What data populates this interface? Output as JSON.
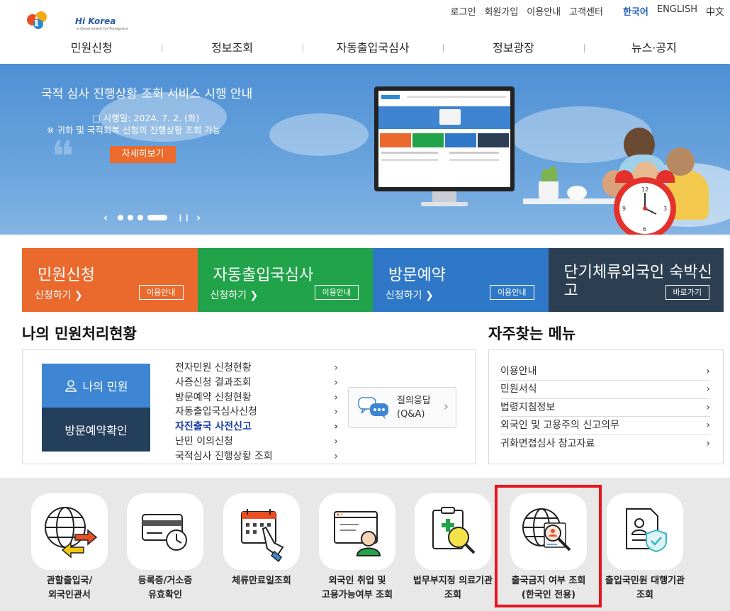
{
  "header": {
    "logo_text": "Hi Korea",
    "logo_sub": "e-Government for Foreigners",
    "utils": [
      "로그인",
      "회원가입",
      "이용안내",
      "고객센터"
    ],
    "langs": [
      "한국어",
      "ENGLISH",
      "中文"
    ]
  },
  "gnb": [
    "민원신청",
    "정보조회",
    "자동출입국심사",
    "정보광장",
    "뉴스·공지"
  ],
  "banner": {
    "title": "국적 심사 진행상황 조회 서비스 시행 안내",
    "line1": "□ 시행일: 2024. 7. 2. (화)",
    "line2": "※ 귀화 및 국적회복 신청의 진행상황 조회 가능",
    "button": "자세히보기",
    "slider": {
      "prev": "‹",
      "next": "›",
      "pause": "❙❙",
      "slides": 4,
      "current": 4
    }
  },
  "tiles": [
    {
      "title": "민원신청",
      "sub": "신청하기 ❯",
      "btn": "이용안내",
      "color": "#ea6a2e"
    },
    {
      "title": "자동출입국심사",
      "sub": "신청하기 ❯",
      "btn": "이용안내",
      "color": "#21a34a"
    },
    {
      "title": "방문예약",
      "sub": "신청하기 ❯",
      "btn": "이용안내",
      "color": "#2f78c7"
    },
    {
      "title": "단기체류외국인 숙박신고",
      "sub": "",
      "btn": "바로가기",
      "color": "#2c3f52"
    }
  ],
  "my_status": {
    "title": "나의 민원처리현황",
    "btn_my": "나의 민원",
    "btn_visit": "방문예약확인",
    "items": [
      "전자민원 신청현황",
      "사증신청 결과조회",
      "방문예약 신청현황",
      "자동출입국심사신청",
      "자진출국 사전신고",
      "난민 이의신청",
      "국적심사 진행상황 조회"
    ],
    "highlighted_index": 4,
    "qna_line1": "질의응답",
    "qna_line2": "(Q&A)"
  },
  "faq": {
    "title": "자주찾는 메뉴",
    "items": [
      "이용안내",
      "민원서식",
      "법령지침정보",
      "외국인 및 고용주의 신고의무",
      "귀화면접심사 참고자료"
    ]
  },
  "quick": [
    {
      "line1": "관할출입국/",
      "line2": "외국인관서",
      "icon": "globe-arrows-icon"
    },
    {
      "line1": "등록증/거소증",
      "line2": "유효확인",
      "icon": "card-clock-icon"
    },
    {
      "line1": "체류만료일조회",
      "line2": "",
      "icon": "calendar-hand-icon"
    },
    {
      "line1": "외국인 취업 및",
      "line2": "고용가능여부 조회",
      "icon": "worker-screen-icon"
    },
    {
      "line1": "법무부지정 의료기관",
      "line2": "조회",
      "icon": "clipboard-search-icon"
    },
    {
      "line1": "출국금지 여부 조회",
      "line2": "(한국인 전용)",
      "icon": "globe-search-icon"
    },
    {
      "line1": "출입국민원 대행기관",
      "line2": "조회",
      "icon": "document-shield-icon"
    }
  ],
  "colors": {
    "accent": "#2f78c7",
    "highlight_box": "#e8151c",
    "banner_button": "#ec6a2b"
  }
}
